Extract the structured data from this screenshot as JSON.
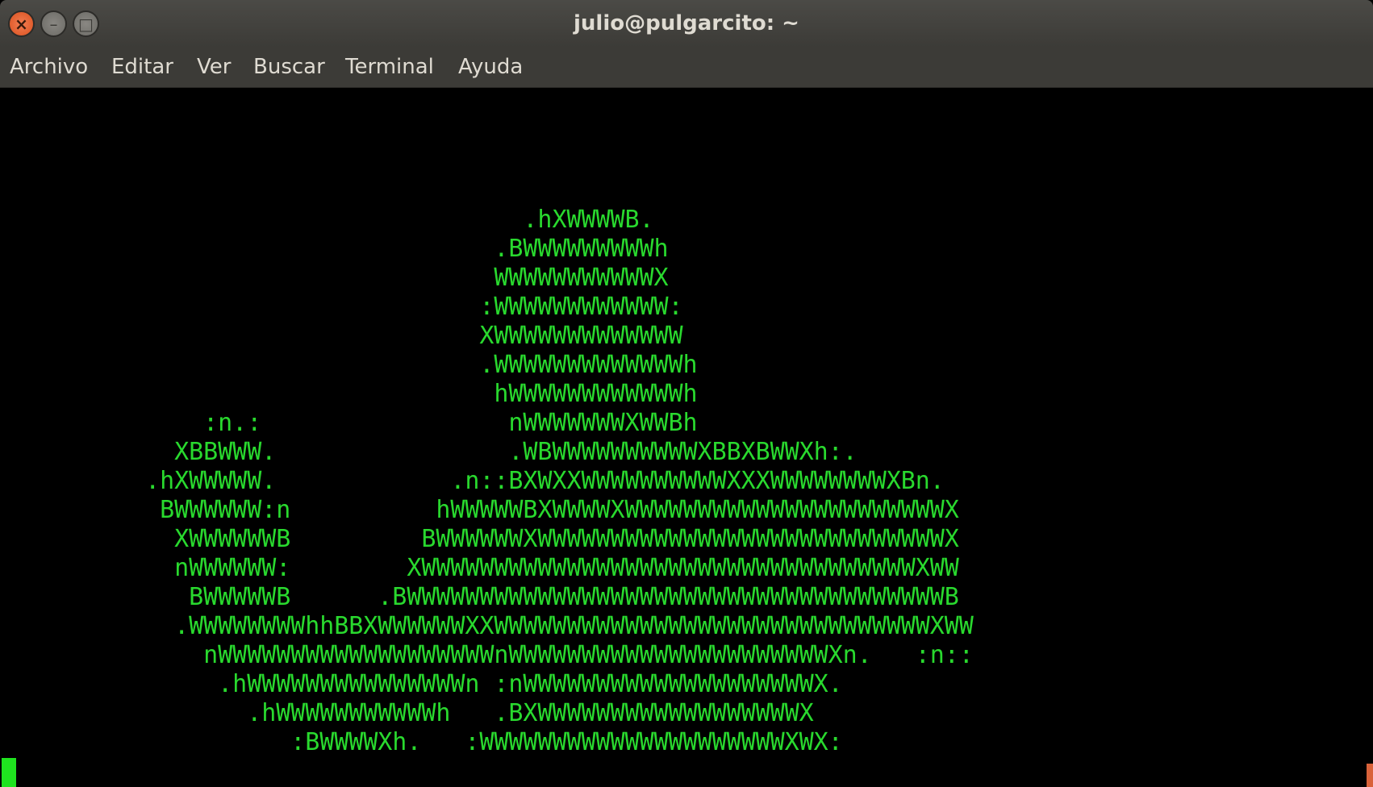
{
  "window": {
    "title": "julio@pulgarcito: ~",
    "buttons": {
      "close": "×",
      "minimize": "–",
      "maximize": "□"
    }
  },
  "menu": [
    {
      "label": "Archivo"
    },
    {
      "label": "Editar"
    },
    {
      "label": "Ver"
    },
    {
      "label": "Buscar"
    },
    {
      "label": "Terminal"
    },
    {
      "label": "Ayuda"
    }
  ],
  "terminal": {
    "art_lines": [
      "                                    .hXWWWWB.",
      "                                  .BWWWWWWWWWh",
      "                                  WWWWWWWWWWWX",
      "                                 :WWWWWWWWWWWW:",
      "                                 XWWWWWWWWWWWWW",
      "                                 .WWWWWWWWWWWWWh",
      "                                  hWWWWWWWWWWWWh",
      "              :n.:                 nWWWWWWWXWWBh",
      "            XBBWWW.                .WBWWWWWWWWWWXBBXBWWXh:.",
      "          .hXWWWWW.            .n::BXWXXWWWWWWWWWWXXXWWWWWWWWXBn.",
      "           BWWWWWW:n          hWWWWWBXWWWWXWWWWWWWWWWWWWWWWWWWWWWX",
      "            XWWWWWWB         BWWWWWWXWWWWWWWWWWWWWWWWWWWWWWWWWWWWX",
      "            nWWWWWW:        XWWWWWWWWWWWWWWWWWWWWWWWWWWWWWWWWWWXWW",
      "             BWWWWWB      .BWWWWWWWWWWWWWWWWWWWWWWWWWWWWWWWWWWWWWB",
      "            .WWWWWWWWhhBBXWWWWWWXXWWWWWWWWWWWWWWWWWWWWWWWWWWWWWWXWW",
      "              nWWWWWWWWWWWWWWWWWWWnWWWWWWWWWWWWWWWWWWWWWWXn.   :n::",
      "               .hWWWWWWWWWWWWWWWn :nWWWWWWWWWWWWWWWWWWWWX.",
      "                 .hWWWWWWWWWWWh   .BXWWWWWWWWWWWWWWWWWWX",
      "                    :BWWWWXh.   :WWWWWWWWWWWWWWWWWWWWWXWX:"
    ]
  },
  "colors": {
    "terminal_bg": "#000000",
    "terminal_fg": "#29d92e",
    "cursor": "#1fe31f",
    "titlebar": "#3c3b37",
    "close_button": "#e95420"
  }
}
